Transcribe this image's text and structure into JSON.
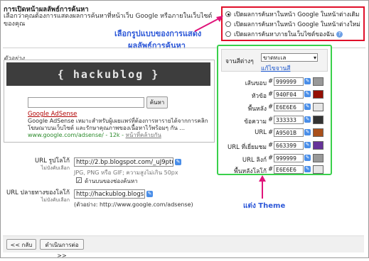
{
  "section": {
    "title": "การเปิดหน้าผลลัพธ์การค้นหา",
    "description": "เลือกว่าคุณต้องการแสดงผลการค้นหาที่หน้าเว็บ Google หรือภายในเว็บไซต์ของคุณ"
  },
  "radio_options": [
    {
      "label": "เปิดผลการค้นหาในหน้า Google ในหน้าต่างเดิม",
      "selected": true
    },
    {
      "label": "เปิดผลการค้นหาในหน้า Google ในหน้าต่างใหม่",
      "selected": false
    },
    {
      "label": "เปิดผลการค้นหาภายในเว็บไซต์ของฉัน",
      "selected": false
    }
  ],
  "annotations": {
    "result_style_line1": "เลือกรูปแบบของการแสดง",
    "result_style_line2": "ผลลัพธ์การค้นหา",
    "theme_note": "แต่ง Theme"
  },
  "preview": {
    "label": "ตัวอย่าง",
    "logo_text": "{ hackublog }",
    "search_button": "ค้นหา",
    "ad_title": "Google AdSense",
    "ad_body": "Google AdSense เหมาะสำหรับผู้เผยแพร่ที่ต้องการหารายได้จากการคลิกโฆษณาบนเว็บไซต์ และรักษาคุณภาพของเนื้อหาไว้พร้อมๆ กัน ...",
    "ad_url": "www.google.com/adsense/ - 12k - ",
    "ad_link": "หน้าที่คล้ายกัน"
  },
  "theme": {
    "label": "จานสีต่างๆ",
    "selected": "ขาดทะเล",
    "edit_link": "แก้ไขจานสี"
  },
  "colors": [
    {
      "label": "เส้นขอบ",
      "hex": "999999",
      "swatch": "#999999"
    },
    {
      "label": "หัวข้อ",
      "hex": "940F04",
      "swatch": "#940F04"
    },
    {
      "label": "พื้นหลัง",
      "hex": "E6E6E6",
      "swatch": "#E6E6E6"
    },
    {
      "label": "ข้อความ",
      "hex": "333333",
      "swatch": "#333333"
    },
    {
      "label": "URL",
      "hex": "A9501B",
      "swatch": "#A9501B"
    },
    {
      "label": "URL ที่เยี่ยมชม",
      "hex": "663399",
      "swatch": "#663399"
    },
    {
      "label": "URL ลิงก์",
      "hex": "999999",
      "swatch": "#999999"
    },
    {
      "label": "พื้นหลังโลโก้",
      "hex": "E6E6E6",
      "swatch": "#E6E6E6"
    }
  ],
  "form": {
    "logo_url_label": "URL รูปโลโก้",
    "logo_url_hint": "ไม่บังคับเลือก",
    "logo_url_value": "http://2.bp.blogspot.com/_uJ9ptu1",
    "logo_url_note": "JPG, PNG หรือ GIF; ความสูงไม่เกิน 50px",
    "center_logo_label": "ด้านบนของช่องค้นหา",
    "center_logo_checked": true,
    "dest_url_label": "URL ปลายทางของโลโก้",
    "dest_url_hint": "ไม่บังคับเลือก",
    "dest_url_value": "http://hackublog.blogsp",
    "dest_url_example": "(ตัวอย่าง: http://www.google.com/adsense)"
  },
  "nav": {
    "back": "<< กลับ",
    "next": "ดำเนินการต่อ >>"
  },
  "colors_accent": {
    "red_box": "#e0102a",
    "green_box": "#39d04b",
    "annotation_blue": "#2d58d8",
    "annotation_magenta": "#e0147a"
  }
}
